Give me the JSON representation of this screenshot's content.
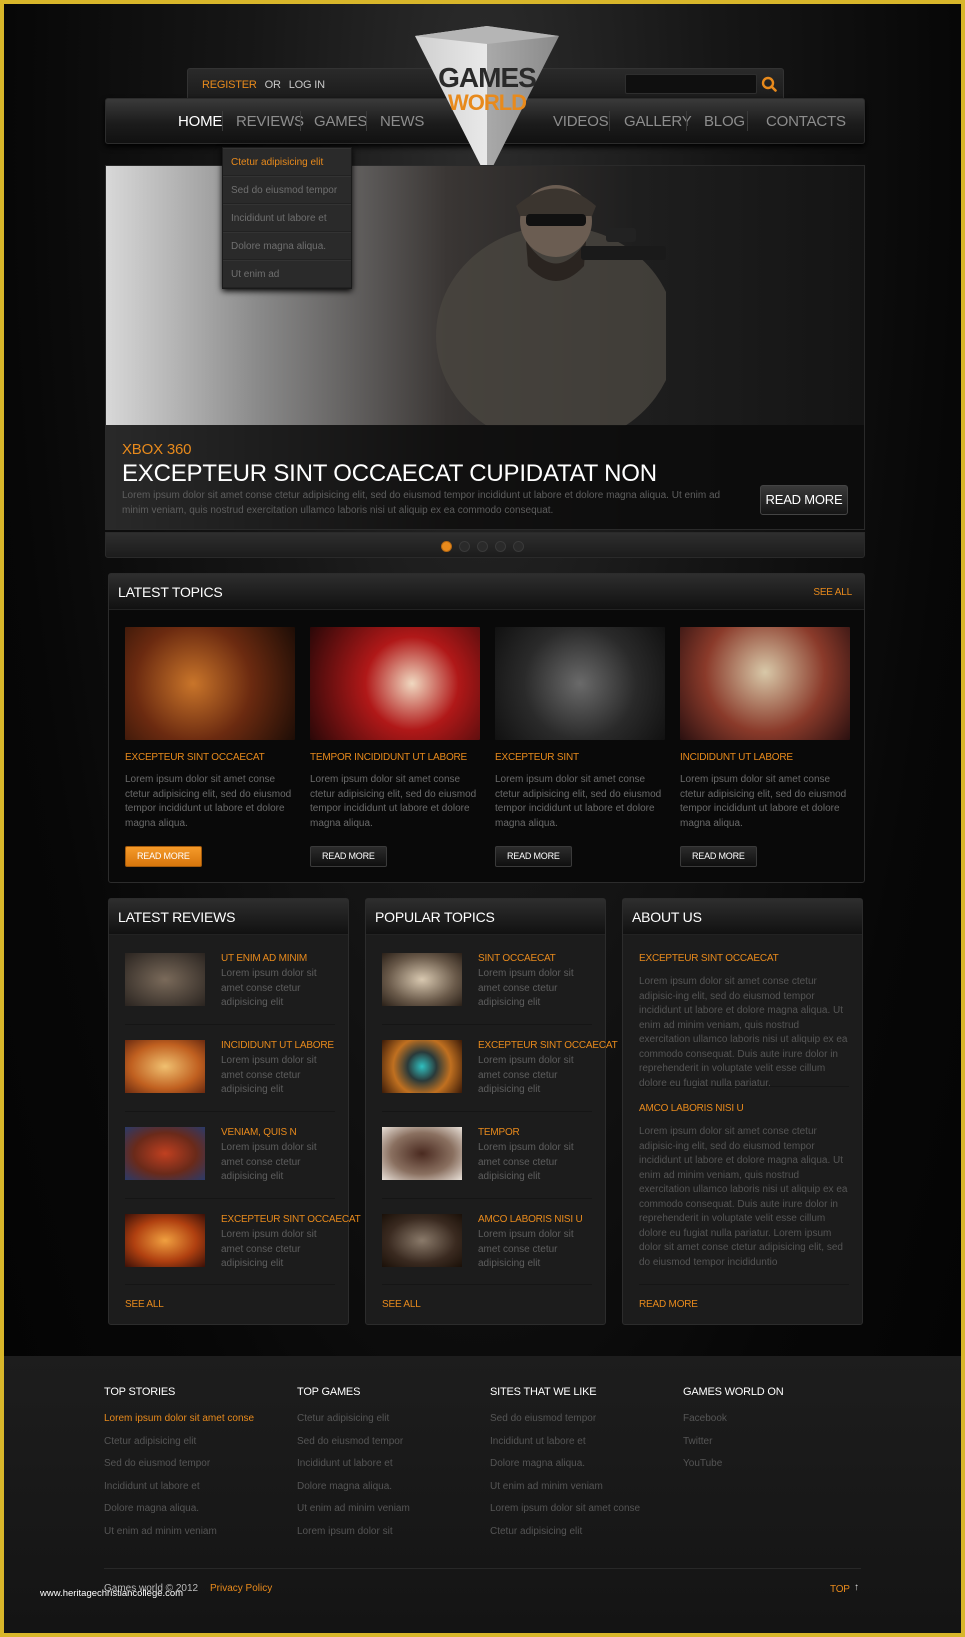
{
  "header": {
    "register": "REGISTER",
    "or": "OR",
    "login": "LOG IN",
    "search_placeholder": "",
    "search_icon": "search-icon",
    "logo_line1": "GAMES",
    "logo_line2": "WORLD"
  },
  "nav": {
    "items": [
      "HOME",
      "REVIEWS",
      "GAMES",
      "NEWS",
      "VIDEOS",
      "GALLERY",
      "BLOG",
      "CONTACTS"
    ],
    "active": "HOME",
    "dropdown": [
      "Ctetur adipisicing elit",
      "Sed do eiusmod tempor",
      "Incididunt ut labore et",
      "Dolore magna aliqua.",
      "Ut enim ad"
    ]
  },
  "slider": {
    "tag": "XBOX 360",
    "title": "EXCEPTEUR SINT OCCAECAT CUPIDATAT NON",
    "text": "Lorem ipsum dolor sit amet conse ctetur adipisicing elit, sed do eiusmod tempor incididunt ut labore et dolore magna aliqua. Ut enim ad minim veniam, quis nostrud exercitation ullamco laboris nisi ut aliquip ex ea commodo consequat.",
    "button": "READ MORE",
    "slide_count": 5,
    "active_slide": 1
  },
  "latest_topics": {
    "title": "LATEST TOPICS",
    "see_all": "SEE ALL",
    "items": [
      {
        "title": "EXCEPTEUR SINT OCCAECAT",
        "text": "Lorem ipsum dolor sit amet conse ctetur adipisicing elit, sed do eiusmod tempor incididunt ut labore et dolore magna aliqua.",
        "button": "READ MORE"
      },
      {
        "title": "TEMPOR INCIDIDUNT UT LABORE",
        "text": "Lorem ipsum dolor sit amet conse ctetur adipisicing elit, sed do eiusmod tempor incididunt ut labore et dolore magna aliqua.",
        "button": "READ MORE"
      },
      {
        "title": "EXCEPTEUR SINT",
        "text": "Lorem ipsum dolor sit amet conse ctetur adipisicing elit, sed do eiusmod tempor incididunt ut labore et dolore magna aliqua.",
        "button": "READ MORE"
      },
      {
        "title": "INCIDIDUNT UT LABORE",
        "text": "Lorem ipsum dolor sit amet conse ctetur adipisicing elit, sed do eiusmod tempor incididunt ut labore et dolore magna aliqua.",
        "button": "READ MORE"
      }
    ]
  },
  "latest_reviews": {
    "title": "LATEST REVIEWS",
    "see_all": "SEE ALL",
    "items": [
      {
        "title": "UT ENIM AD MINIM",
        "text": "Lorem ipsum dolor sit amet conse ctetur adipisicing elit"
      },
      {
        "title": "INCIDIDUNT UT LABORE",
        "text": "Lorem ipsum dolor sit amet conse ctetur adipisicing elit"
      },
      {
        "title": "VENIAM, QUIS N",
        "text": "Lorem ipsum dolor sit amet conse ctetur adipisicing elit"
      },
      {
        "title": "EXCEPTEUR SINT OCCAECAT",
        "text": "Lorem ipsum dolor sit amet conse ctetur adipisicing elit"
      }
    ]
  },
  "popular_topics": {
    "title": "POPULAR TOPICS",
    "see_all": "SEE ALL",
    "items": [
      {
        "title": "SINT OCCAECAT",
        "text": "Lorem ipsum dolor sit amet conse ctetur adipisicing elit"
      },
      {
        "title": "EXCEPTEUR SINT OCCAECAT",
        "text": "Lorem ipsum dolor sit amet conse ctetur adipisicing elit"
      },
      {
        "title": "TEMPOR",
        "text": "Lorem ipsum dolor sit amet conse ctetur adipisicing elit"
      },
      {
        "title": "AMCO LABORIS NISI U",
        "text": "Lorem ipsum dolor sit amet conse ctetur adipisicing elit"
      }
    ]
  },
  "about_us": {
    "title": "ABOUT US",
    "sections": [
      {
        "title": "EXCEPTEUR SINT OCCAECAT",
        "text": "Lorem ipsum dolor sit amet conse ctetur adipisic-ing elit, sed do eiusmod tempor incididunt ut labore et dolore magna aliqua. Ut enim ad minim veniam, quis nostrud exercitation ullamco laboris nisi ut aliquip ex ea commodo consequat. Duis aute irure dolor in reprehenderit in voluptate velit esse cillum dolore eu fugiat nulla pariatur."
      },
      {
        "title": "AMCO LABORIS NISI U",
        "text": "Lorem ipsum dolor sit amet conse ctetur adipisic-ing elit, sed do eiusmod tempor incididunt ut labore et dolore magna aliqua. Ut enim ad minim veniam, quis nostrud exercitation ullamco laboris nisi ut aliquip ex ea commodo consequat. Duis aute irure dolor in reprehenderit in voluptate velit esse cillum dolore eu fugiat nulla pariatur. Lorem ipsum dolor sit amet conse ctetur adipisicing elit, sed do eiusmod tempor incididuntio"
      }
    ],
    "read_more": "READ MORE"
  },
  "footer": {
    "columns": [
      {
        "title": "TOP STORIES",
        "links": [
          "Lorem ipsum dolor sit amet conse",
          "Ctetur adipisicing elit",
          "Sed do eiusmod tempor",
          "Incididunt ut labore et",
          "Dolore magna aliqua.",
          "Ut enim ad minim veniam"
        ],
        "active_index": 0
      },
      {
        "title": "TOP GAMES",
        "links": [
          "Ctetur adipisicing elit",
          "Sed do eiusmod tempor",
          "Incididunt ut labore et",
          "Dolore magna aliqua.",
          "Ut enim ad minim veniam",
          "Lorem ipsum dolor sit"
        ]
      },
      {
        "title": "SITES THAT WE LIKE",
        "links": [
          "Sed do eiusmod tempor",
          "Incididunt ut labore et",
          "Dolore magna aliqua.",
          "Ut enim ad minim veniam",
          "Lorem ipsum dolor sit amet conse",
          "Ctetur adipisicing elit"
        ]
      },
      {
        "title": "GAMES WORLD ON",
        "links": [
          "Facebook",
          "Twitter",
          "YouTube"
        ]
      }
    ],
    "copyright": "Games world © 2012",
    "privacy": "Privacy Policy",
    "top": "TOP",
    "top_arrow": "↑",
    "watermark": "www.heritagechristiancollege.com"
  },
  "colors": {
    "accent": "#e88a1c",
    "frame": "#d8b62a",
    "background": "#0b0b0b"
  }
}
